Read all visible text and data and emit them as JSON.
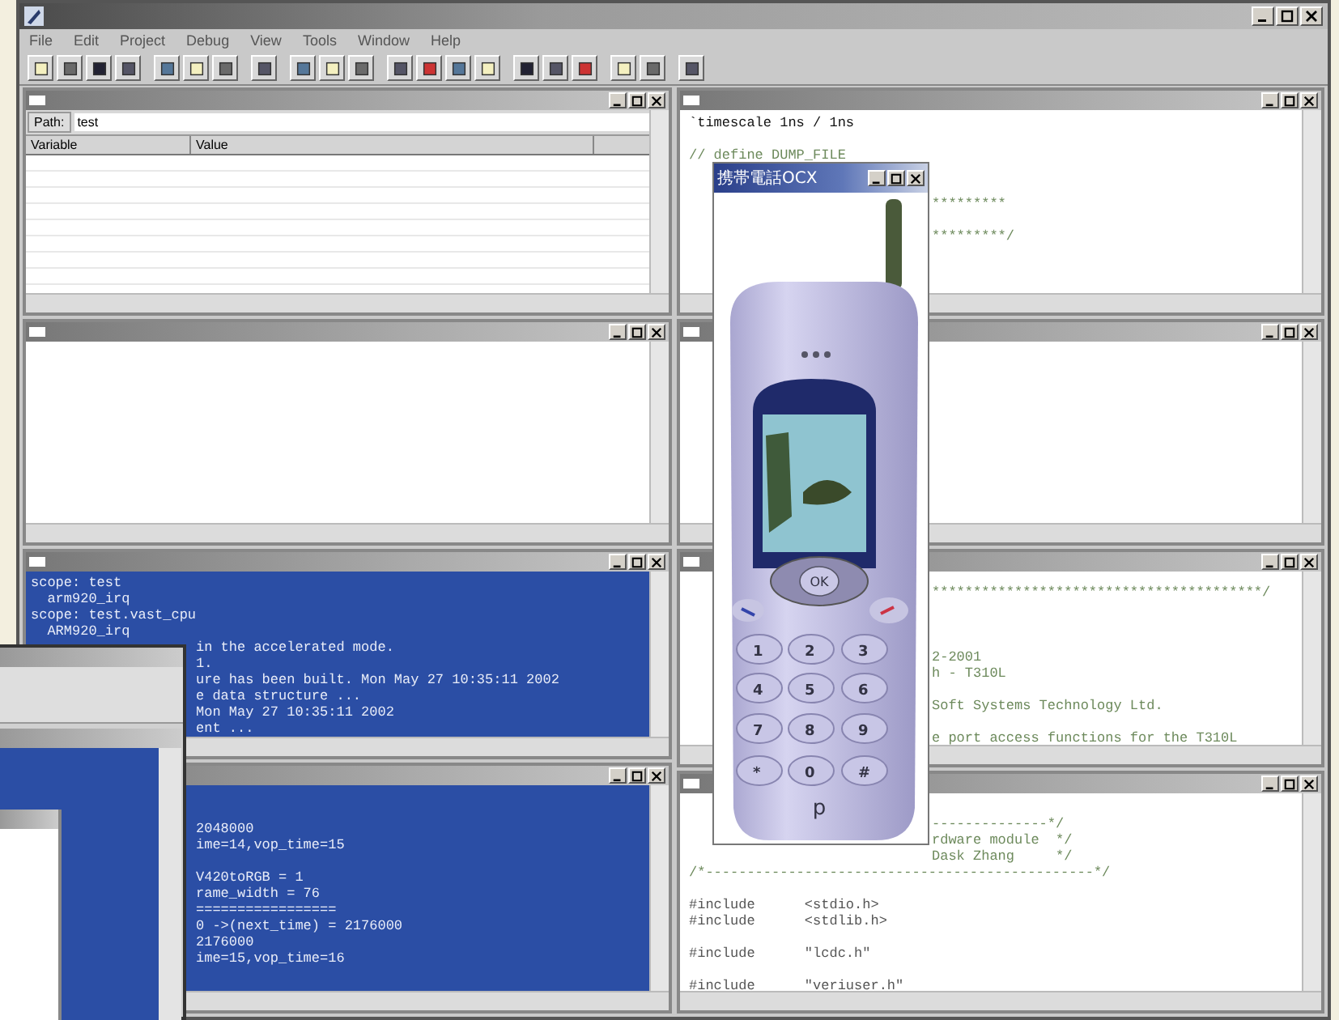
{
  "menu": [
    {
      "label": "File"
    },
    {
      "label": "Edit"
    },
    {
      "label": "Project"
    },
    {
      "label": "Debug"
    },
    {
      "label": "View"
    },
    {
      "label": "Tools"
    },
    {
      "label": "Window"
    },
    {
      "label": "Help"
    }
  ],
  "left_panels": [
    {
      "kind": "watch",
      "path_label": "Path:",
      "path": "test",
      "columns": [
        "Variable",
        "Value"
      ]
    },
    {
      "kind": "output"
    },
    {
      "kind": "console",
      "lines": [
        {
          "kind": "text",
          "text": "scope: test"
        },
        {
          "kind": "text",
          "text": "  arm920_irq"
        },
        {
          "kind": "text",
          "text": "scope: test.vast_cpu"
        },
        {
          "kind": "text",
          "text": "  ARM920_irq"
        },
        {
          "kind": "clipped",
          "text": "in the accelerated mode."
        },
        {
          "kind": "clipped",
          "text": "1."
        },
        {
          "kind": "clipped",
          "text": "ure has been built. Mon May 27 10:35:11 2002"
        },
        {
          "kind": "clipped",
          "text": "e data structure ..."
        },
        {
          "kind": "clipped",
          "text": "Mon May 27 10:35:11 2002"
        },
        {
          "kind": "clipped",
          "text": "ent ..."
        }
      ]
    },
    {
      "kind": "console",
      "lines": [
        {
          "kind": "blank"
        },
        {
          "kind": "blank"
        },
        {
          "kind": "clipped",
          "text": "2048000"
        },
        {
          "kind": "clipped",
          "text": "ime=14,vop_time=15"
        },
        {
          "kind": "blank"
        },
        {
          "kind": "clipped",
          "text": "V420toRGB = 1"
        },
        {
          "kind": "clipped",
          "text": "rame_width = 76"
        },
        {
          "kind": "clipped",
          "text": "================="
        },
        {
          "kind": "clipped",
          "text": "0 ->(next_time) = 2176000"
        },
        {
          "kind": "clipped",
          "text": "2176000"
        },
        {
          "kind": "clipped",
          "text": "ime=15,vop_time=16"
        }
      ]
    }
  ],
  "right_panels": [
    {
      "kind": "editor",
      "lines": [
        {
          "kind": "code",
          "text": "`timescale 1ns / 1ns"
        },
        {
          "kind": "blank"
        },
        {
          "kind": "comment",
          "text": "// define DUMP_FILE"
        },
        {
          "kind": "blank"
        },
        {
          "kind": "blank"
        },
        {
          "kind": "clipped_comment",
          "text": "*********"
        },
        {
          "kind": "blank"
        },
        {
          "kind": "clipped_comment",
          "text": "*********/"
        }
      ]
    },
    {
      "kind": "editor"
    },
    {
      "kind": "editor",
      "lines": [
        {
          "kind": "clipped_comment",
          "text": "****************************************/"
        },
        {
          "kind": "blank"
        },
        {
          "kind": "blank"
        },
        {
          "kind": "blank"
        },
        {
          "kind": "clipped_comment",
          "text": "2-2001"
        },
        {
          "kind": "clipped_comment",
          "text": "h - T310L"
        },
        {
          "kind": "blank"
        },
        {
          "kind": "clipped_comment",
          "text": "Soft Systems Technology Ltd."
        },
        {
          "kind": "blank"
        },
        {
          "kind": "clipped_comment",
          "text": "e port access functions for the T310L"
        }
      ]
    },
    {
      "kind": "editor",
      "lines": [
        {
          "kind": "clipped_comment",
          "text": "--------------*/"
        },
        {
          "kind": "clipped_comment",
          "text": "rdware module  */"
        },
        {
          "kind": "clipped_comment",
          "text": "Dask Zhang     */"
        },
        {
          "kind": "comment",
          "text": "/*-----------------------------------------------*/"
        },
        {
          "kind": "blank"
        },
        {
          "kind": "directive",
          "text": "#include      <stdio.h>"
        },
        {
          "kind": "directive",
          "text": "#include      <stdlib.h>"
        },
        {
          "kind": "blank"
        },
        {
          "kind": "directive",
          "text": "#include      \"lcdc.h\""
        },
        {
          "kind": "blank"
        },
        {
          "kind": "directive",
          "text": "#include      \"veriuser.h\""
        }
      ]
    }
  ],
  "phone_window": {
    "title": "携帯電話OCX",
    "ok_label": "OK",
    "keys": [
      "1",
      "2",
      "3",
      "4",
      "5",
      "6",
      "7",
      "8",
      "9",
      "*",
      "0",
      "#"
    ],
    "logo": "p"
  }
}
